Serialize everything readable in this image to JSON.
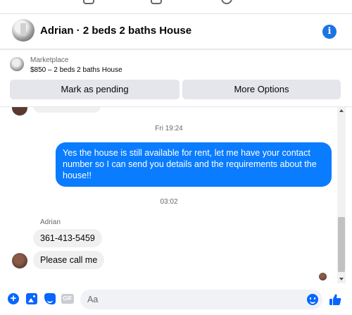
{
  "conversation": {
    "title": "Adrian · 2 beds 2 baths House",
    "info_icon": "info-icon",
    "info_glyph": "i"
  },
  "marketplace": {
    "label": "Marketplace",
    "listing": "$850 – 2 beds 2 baths House",
    "mark_pending_label": "Mark as pending",
    "more_options_label": "More Options"
  },
  "messages": {
    "timestamp_1": "Fri 19:24",
    "outgoing_1": "Yes the house is still available for rent, let me have your contact number so I can send you details and the requirements about the house!!",
    "timestamp_2": "03:02",
    "sender_name": "Adrian",
    "incoming_1": "361-413-5459",
    "incoming_2": "Please call me"
  },
  "composer": {
    "placeholder": "Aa",
    "plus_glyph": "+",
    "gif_label": "GIF",
    "icons": [
      "plus-icon",
      "photo-icon",
      "sticker-icon",
      "gif-icon",
      "emoji-icon",
      "thumbs-up-icon"
    ]
  },
  "colors": {
    "accent": "#0866ff",
    "outgoing_bubble": "#0a7cff",
    "incoming_bubble": "#f0f0f0",
    "button_bg": "#e4e6eb"
  }
}
